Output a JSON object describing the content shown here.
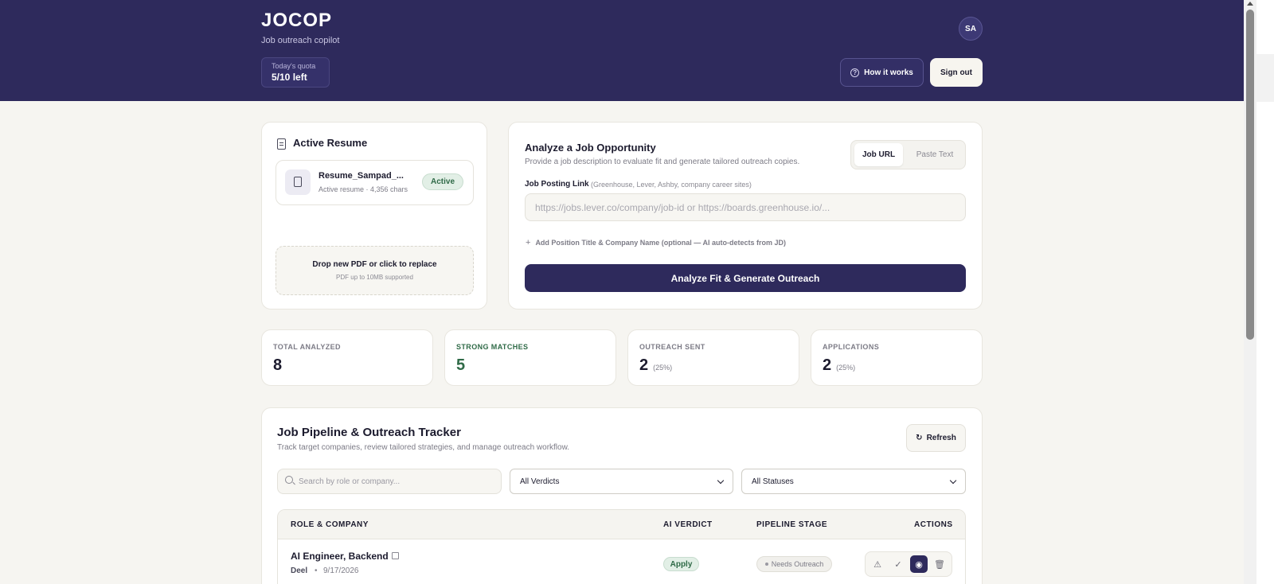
{
  "header": {
    "logo": "JOCOP",
    "tagline": "Job outreach copilot",
    "quota_label": "Today's quota",
    "quota_value": "5/10 left",
    "avatar_initials": "SA",
    "how_it_works": "How it works",
    "sign_out": "Sign out"
  },
  "resume": {
    "title": "Active Resume",
    "file_name": "Resume_Sampad_...",
    "file_meta": "Active resume · 4,356 chars",
    "badge": "Active",
    "drop_title": "Drop new PDF or click to replace",
    "drop_sub": "PDF up to 10MB supported"
  },
  "analyze": {
    "title": "Analyze a Job Opportunity",
    "subtitle": "Provide a job description to evaluate fit and generate tailored outreach copies.",
    "tab_url": "Job URL",
    "tab_text": "Paste Text",
    "field_label": "Job Posting Link",
    "field_hint": "(Greenhouse, Lever, Ashby, company career sites)",
    "url_placeholder": "https://jobs.lever.co/company/job-id or https://boards.greenhouse.io/...",
    "add_position": "Add Position Title & Company Name (optional — AI auto-detects from JD)",
    "button": "Analyze Fit & Generate Outreach"
  },
  "stats": [
    {
      "label": "TOTAL ANALYZED",
      "value": "8",
      "pct": ""
    },
    {
      "label": "STRONG MATCHES",
      "value": "5",
      "pct": ""
    },
    {
      "label": "OUTREACH SENT",
      "value": "2",
      "pct": "(25%)"
    },
    {
      "label": "APPLICATIONS",
      "value": "2",
      "pct": "(25%)"
    }
  ],
  "pipeline": {
    "title": "Job Pipeline & Outreach Tracker",
    "subtitle": "Track target companies, review tailored strategies, and manage outreach workflow.",
    "refresh": "Refresh",
    "search_placeholder": "Search by role or company...",
    "verdict_filter": "All Verdicts",
    "status_filter": "All Statuses",
    "columns": [
      "ROLE & COMPANY",
      "AI VERDICT",
      "PIPELINE STAGE",
      "ACTIONS"
    ],
    "rows": [
      {
        "role": "AI Engineer, Backend",
        "company": "Deel",
        "date": "9/17/2026",
        "verdict": "Apply",
        "stage": "Needs Outreach"
      }
    ]
  },
  "colors": {
    "brand": "#2e2a5c",
    "background": "#f6f5f1",
    "success": "#2f6a47"
  }
}
